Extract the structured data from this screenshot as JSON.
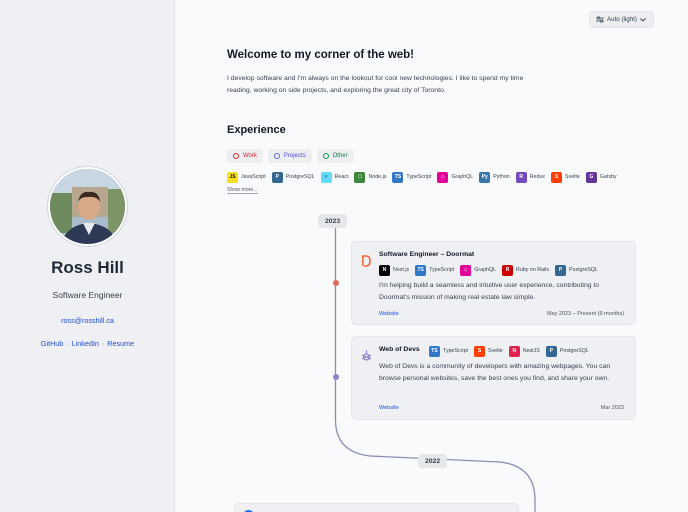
{
  "sidebar": {
    "name": "Ross Hill",
    "role": "Software Engineer",
    "email": "ross@rosshill.ca",
    "links": [
      {
        "label": "GitHub"
      },
      {
        "label": "LinkedIn"
      },
      {
        "label": "Resume"
      }
    ],
    "separator": "·"
  },
  "theme_toggle": {
    "label": "Auto (light)"
  },
  "main": {
    "welcome_title": "Welcome to my corner of the web!",
    "intro": "I develop software and I'm always on the lookout for cool new technologies. I like to spend my time reading, working on side projects, and exploring the great city of Toronto.",
    "experience_title": "Experience",
    "filters": [
      {
        "label": "Work",
        "color": "#dc2626"
      },
      {
        "label": "Projects",
        "color": "#6366f1"
      },
      {
        "label": "Other",
        "color": "#16a34a"
      }
    ],
    "techs": [
      {
        "label": "JavaScript",
        "icon": "javascript-icon",
        "color": "#f7df1e"
      },
      {
        "label": "PostgreSQL",
        "icon": "postgresql-icon",
        "color": "#336791"
      },
      {
        "label": "React",
        "icon": "react-icon",
        "color": "#61dafb"
      },
      {
        "label": "Node.js",
        "icon": "nodejs-icon",
        "color": "#3c873a"
      },
      {
        "label": "TypeScript",
        "icon": "typescript-icon",
        "color": "#3178c6"
      },
      {
        "label": "GraphQL",
        "icon": "graphql-icon",
        "color": "#e10098"
      },
      {
        "label": "Python",
        "icon": "python-icon",
        "color": "#3776ab"
      },
      {
        "label": "Redux",
        "icon": "redux-icon",
        "color": "#764abc"
      },
      {
        "label": "Svelte",
        "icon": "svelte-icon",
        "color": "#ff3e00"
      },
      {
        "label": "Gatsby",
        "icon": "gatsby-icon",
        "color": "#663399"
      }
    ],
    "show_more": "Show more..."
  },
  "timeline": {
    "years": [
      "2023",
      "2022"
    ],
    "entries": [
      {
        "title": "Software Engineer – Doormat",
        "logo": "doormat-logo-icon",
        "dot_color": "#e06a5a",
        "techs": [
          {
            "label": "Next.js",
            "icon": "nextjs-icon",
            "color": "#000000"
          },
          {
            "label": "TypeScript",
            "icon": "typescript-icon",
            "color": "#3178c6"
          },
          {
            "label": "GraphQL",
            "icon": "graphql-icon",
            "color": "#e10098"
          },
          {
            "label": "Ruby on Rails",
            "icon": "rails-icon",
            "color": "#cc0000"
          },
          {
            "label": "PostgreSQL",
            "icon": "postgresql-icon",
            "color": "#336791"
          }
        ],
        "description": "I'm helping build a seamless and intuitive user experience, contributing to Doormat's mission of making real estate law simple.",
        "link": "Website",
        "date": "May 2023 – Present (9 months)"
      },
      {
        "title": "Web of Devs",
        "logo": "web-of-devs-logo-icon",
        "dot_color": "#8b85c8",
        "techs": [
          {
            "label": "TypeScript",
            "icon": "typescript-icon",
            "color": "#3178c6"
          },
          {
            "label": "Svelte",
            "icon": "svelte-icon",
            "color": "#ff3e00"
          },
          {
            "label": "NestJS",
            "icon": "nestjs-icon",
            "color": "#e0234e"
          },
          {
            "label": "PostgreSQL",
            "icon": "postgresql-icon",
            "color": "#336791"
          }
        ],
        "description": "Web of Devs is a community of developers with amazing webpages. You can browse personal websites, save the best ones you find, and share your own.",
        "link": "Website",
        "date": "Mar 2023"
      }
    ]
  }
}
